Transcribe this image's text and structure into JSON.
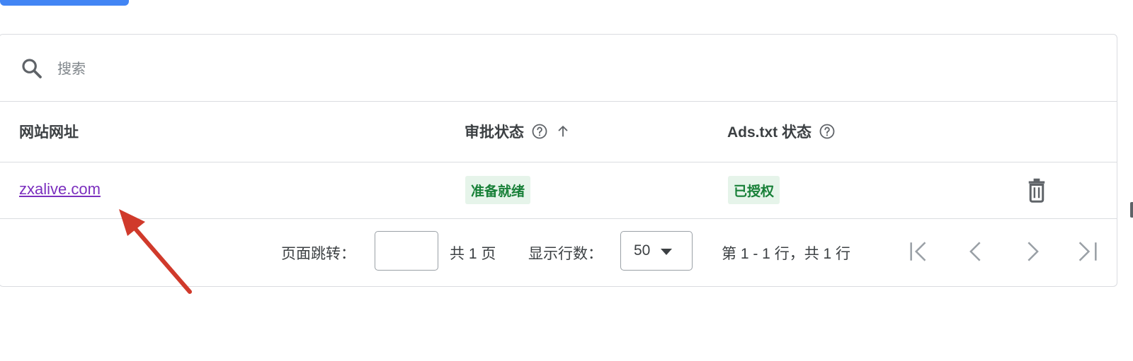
{
  "search": {
    "placeholder": "搜索"
  },
  "table": {
    "columns": {
      "site_url": "网站网址",
      "approval_status": "审批状态",
      "ads_txt_status": "Ads.txt 状态"
    },
    "rows": [
      {
        "site_url": "zxalive.com",
        "approval_status": "准备就绪",
        "ads_txt_status": "已授权"
      }
    ]
  },
  "pagination": {
    "jump_label": "页面跳转：",
    "page_input_value": "",
    "total_pages_label": "共 1 页",
    "rows_per_page_label": "显示行数：",
    "rows_per_page_value": "50",
    "range_label": "第 1 - 1 行，共 1 行"
  },
  "colors": {
    "link": "#7b2fbe",
    "status_chip_bg": "#e6f4ea",
    "status_chip_text": "#188038",
    "annotation_arrow": "#d03a2b",
    "primary_button": "#4285f4"
  },
  "icons": {
    "search": "search-icon",
    "help": "help-circle-icon",
    "sort": "arrow-up-icon",
    "delete": "trash-icon",
    "first": "first-page-icon",
    "prev": "chevron-left-icon",
    "next": "chevron-right-icon",
    "last": "last-page-icon",
    "caret": "caret-down-icon"
  }
}
